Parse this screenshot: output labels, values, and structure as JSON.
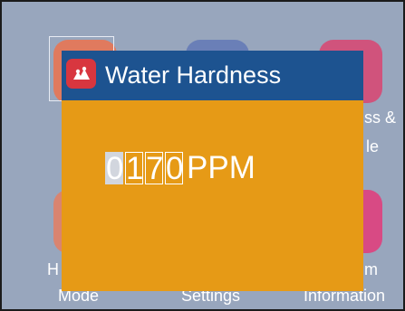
{
  "background": {
    "tiles": [
      {
        "label_line1": "H",
        "label_line2": "Mode"
      },
      {
        "label_line1": "",
        "label_line2": "Settings"
      },
      {
        "label_line1": "ss &",
        "label_line2": "le"
      },
      {
        "label_line1": "m",
        "label_line2": "Information"
      }
    ]
  },
  "dialog": {
    "icon": "hardness-icon",
    "title": "Water Hardness",
    "digits": [
      "0",
      "1",
      "7",
      "0"
    ],
    "active_digit_index": 0,
    "unit": "PPM"
  },
  "colors": {
    "background": "#98a6bd",
    "header": "#1d5390",
    "dialog_body": "#e69a16",
    "icon_bg": "#d8363f",
    "active_digit": "#d2d6de"
  }
}
